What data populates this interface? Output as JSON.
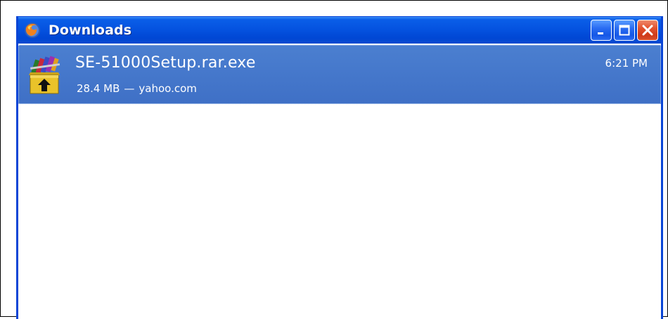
{
  "window": {
    "title": "Downloads",
    "buttons": {
      "minimize": "minimize",
      "maximize": "maximize",
      "close": "close"
    }
  },
  "downloads": [
    {
      "filename": "SE-51000Setup.rar.exe",
      "size": "28.4 MB",
      "separator": "—",
      "source": "yahoo.com",
      "time": "6:21 PM",
      "icon": "winrar-archive-icon",
      "selected": true
    }
  ],
  "colors": {
    "titlebar": "#0553e0",
    "selected_row": "#4578cb",
    "close_button": "#e2522d"
  }
}
